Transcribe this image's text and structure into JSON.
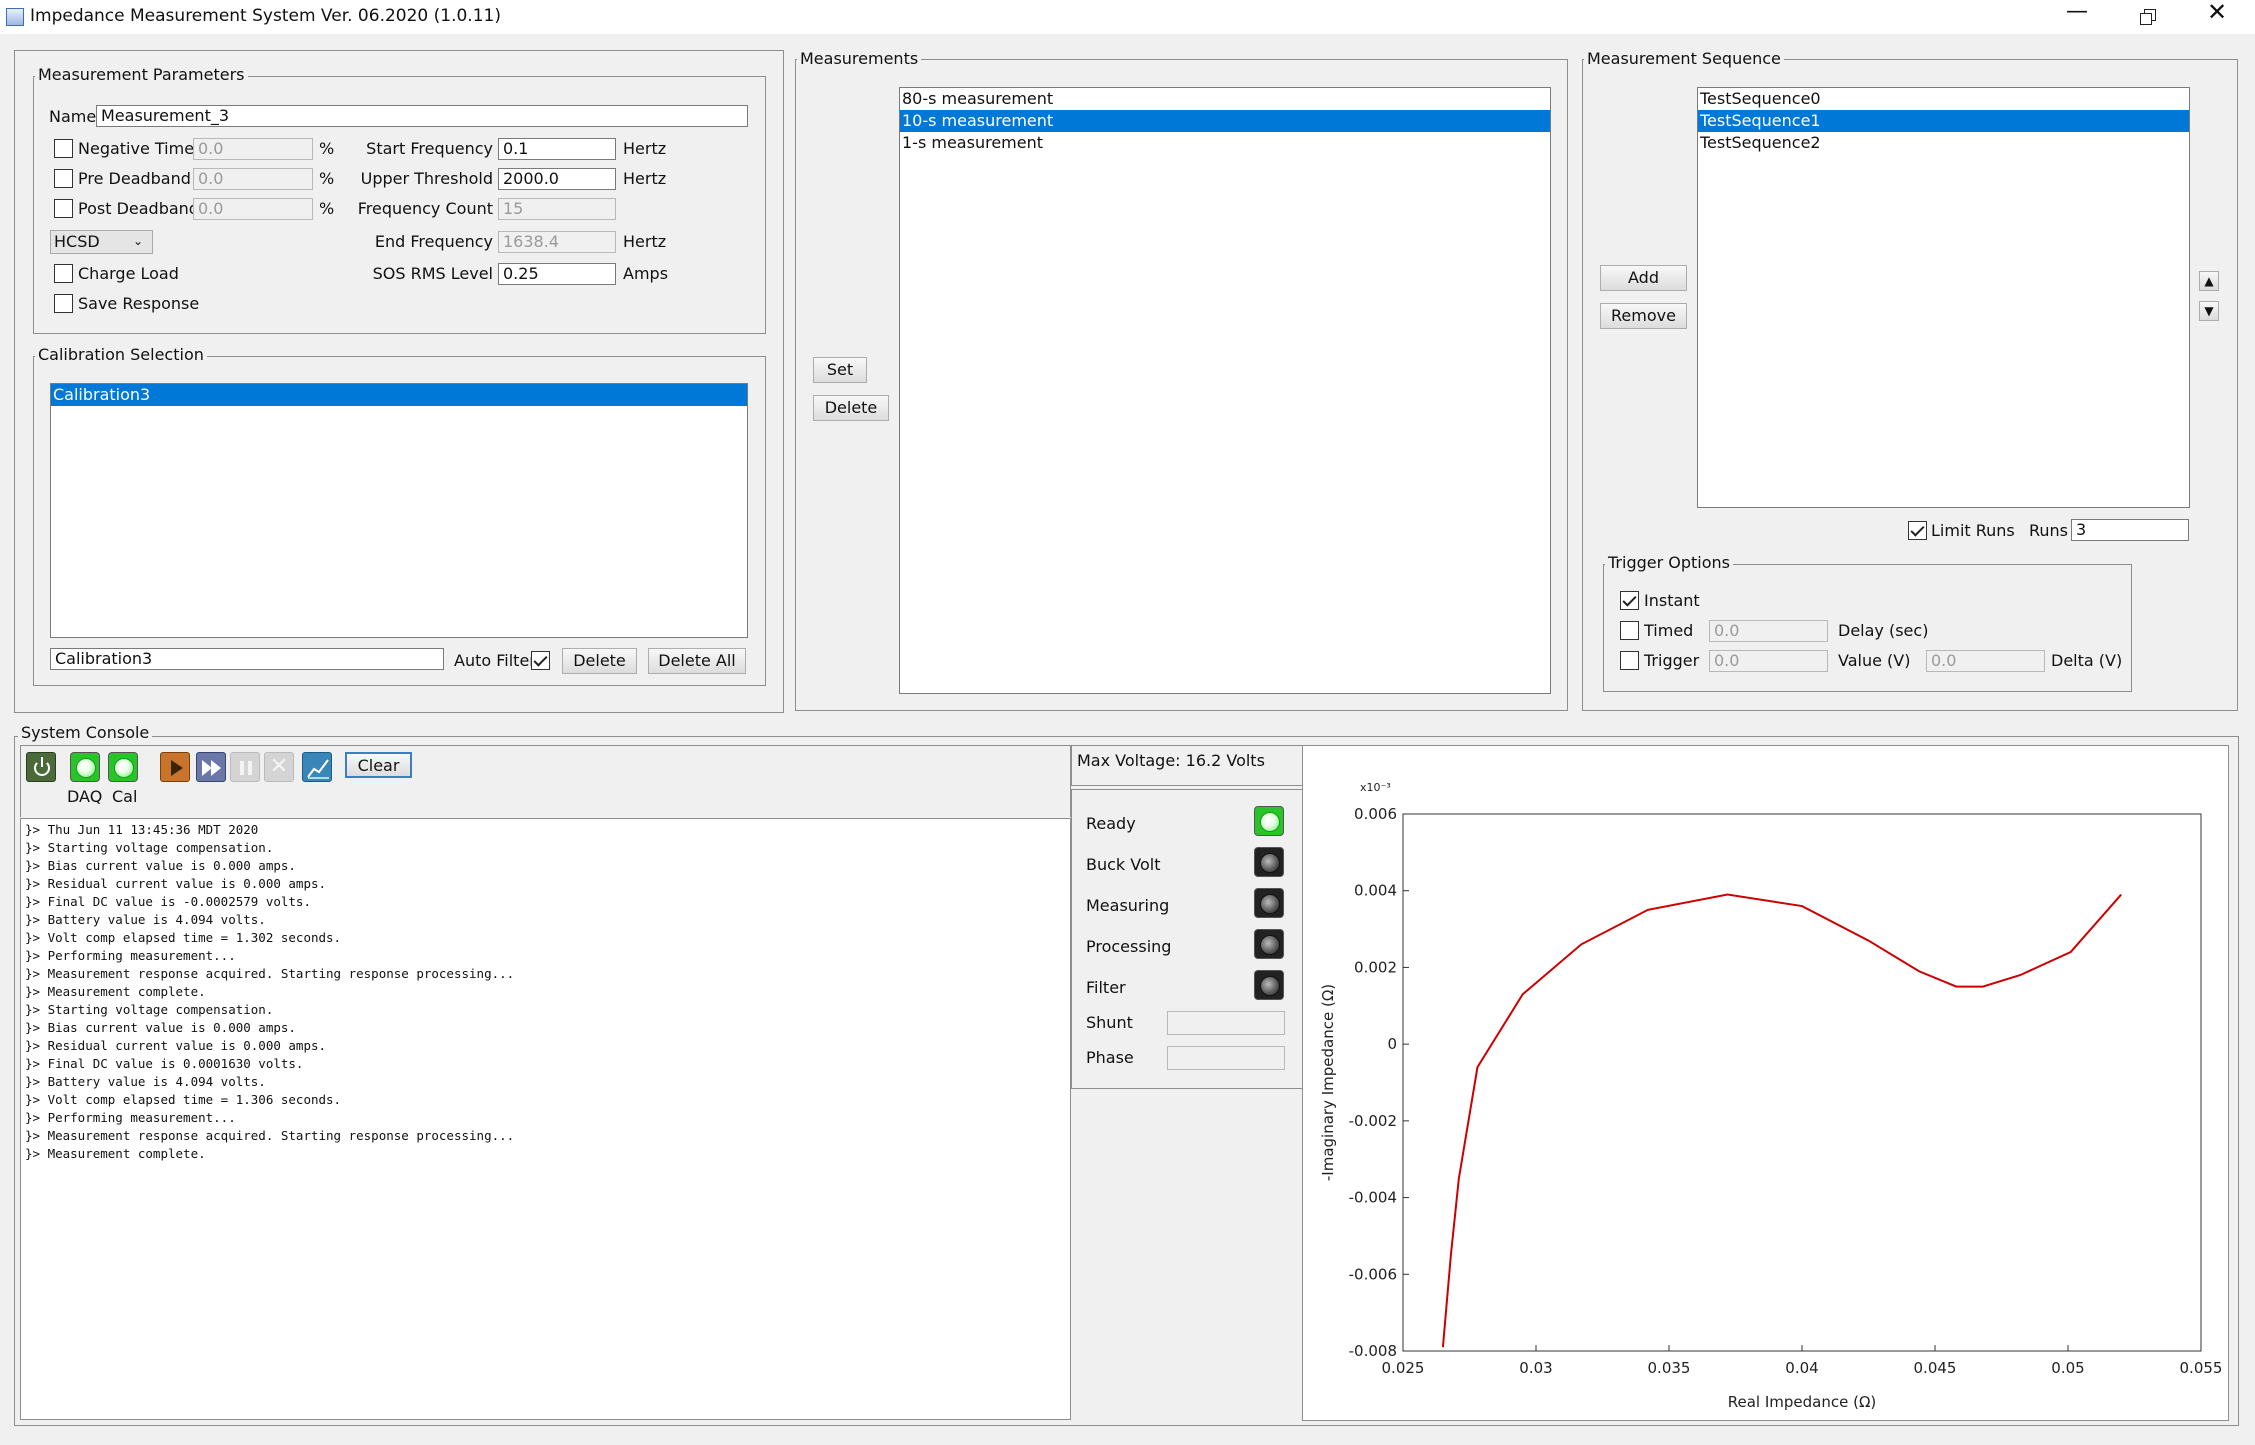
{
  "window": {
    "title": "Impedance Measurement System Ver. 06.2020 (1.0.11)"
  },
  "params": {
    "group": "Measurement Parameters",
    "name_label": "Name",
    "name_value": "Measurement_3",
    "neg_time": "Negative Time",
    "neg_time_val": "0.0",
    "pre_db": "Pre Deadband",
    "pre_db_val": "0.0",
    "post_db": "Post Deadband",
    "post_db_val": "0.0",
    "pct": "%",
    "mode": "HCSD",
    "charge_load": "Charge Load",
    "save_response": "Save Response",
    "start_freq": "Start Frequency",
    "start_freq_val": "0.1",
    "upper_thr": "Upper Threshold",
    "upper_thr_val": "2000.0",
    "freq_count": "Frequency Count",
    "freq_count_val": "15",
    "end_freq": "End Frequency",
    "end_freq_val": "1638.4",
    "sos": "SOS RMS Level",
    "sos_val": "0.25",
    "hertz": "Hertz",
    "amps": "Amps"
  },
  "calibration": {
    "group": "Calibration Selection",
    "items": [
      "Calibration3"
    ],
    "field": "Calibration3",
    "auto_filter": "Auto Filter",
    "delete": "Delete",
    "delete_all": "Delete All"
  },
  "measurements": {
    "group": "Measurements",
    "set": "Set",
    "delete": "Delete",
    "items": [
      "80-s measurement",
      "10-s measurement",
      "1-s measurement"
    ]
  },
  "sequence": {
    "group": "Measurement Sequence",
    "items": [
      "TestSequence0",
      "TestSequence1",
      "TestSequence2"
    ],
    "add": "Add",
    "remove": "Remove",
    "limit_runs": "Limit Runs",
    "runs_label": "Runs",
    "runs_val": "3"
  },
  "trigger": {
    "group": "Trigger Options",
    "instant": "Instant",
    "timed": "Timed",
    "timed_val": "0.0",
    "delay": "Delay (sec)",
    "trigger": "Trigger",
    "trigger_val": "0.0",
    "value": "Value (V)",
    "delta_val": "0.0",
    "delta": "Delta (V)"
  },
  "console": {
    "group": "System Console",
    "clear": "Clear",
    "daq": "DAQ",
    "cal": "Cal",
    "lines": [
      "}> Thu Jun 11 13:45:36 MDT 2020",
      "}> Starting voltage compensation.",
      "}> Bias current value is 0.000 amps.",
      "}> Residual current value is 0.000 amps.",
      "}> Final DC value is -0.0002579 volts.",
      "}> Battery value is 4.094 volts.",
      "}> Volt comp elapsed time = 1.302 seconds.",
      "}> Performing measurement...",
      "}> Measurement response acquired. Starting response processing...",
      "}> Measurement complete.",
      "}> Starting voltage compensation.",
      "}> Bias current value is 0.000 amps.",
      "}> Residual current value is 0.000 amps.",
      "}> Final DC value is 0.0001630 volts.",
      "}> Battery value is 4.094 volts.",
      "}> Volt comp elapsed time = 1.306 seconds.",
      "}> Performing measurement...",
      "}> Measurement response acquired. Starting response processing...",
      "}> Measurement complete."
    ]
  },
  "status": {
    "max_voltage": "Max Voltage:  16.2 Volts",
    "ready": "Ready",
    "buck": "Buck Volt",
    "measuring": "Measuring",
    "processing": "Processing",
    "filter": "Filter",
    "shunt": "Shunt",
    "phase": "Phase"
  },
  "chart_data": {
    "type": "line",
    "xlabel": "Real Impedance (Ω)",
    "ylabel": "-Imaginary Impedance (Ω)",
    "y_exponent_label": "x10⁻³",
    "xlim": [
      0.025,
      0.055
    ],
    "ylim": [
      -0.008,
      0.006
    ],
    "x_ticks": [
      "0.025",
      "0.03",
      "0.035",
      "0.04",
      "0.045",
      "0.05",
      "0.055"
    ],
    "y_ticks": [
      "0.006",
      "0.004",
      "0.002",
      "0",
      "-0.002",
      "-0.004",
      "-0.006",
      "-0.008"
    ],
    "grid": false,
    "line_color": "#cc0000",
    "x": [
      0.0265,
      0.0268,
      0.0271,
      0.0278,
      0.0295,
      0.0317,
      0.0342,
      0.0372,
      0.04,
      0.0425,
      0.0444,
      0.0458,
      0.0468,
      0.0482,
      0.0501,
      0.052
    ],
    "y": [
      -0.0079,
      -0.0055,
      -0.0035,
      -0.0006,
      0.0013,
      0.0026,
      0.0035,
      0.0039,
      0.0036,
      0.0027,
      0.0019,
      0.0015,
      0.0015,
      0.0018,
      0.0024,
      0.0039
    ]
  }
}
